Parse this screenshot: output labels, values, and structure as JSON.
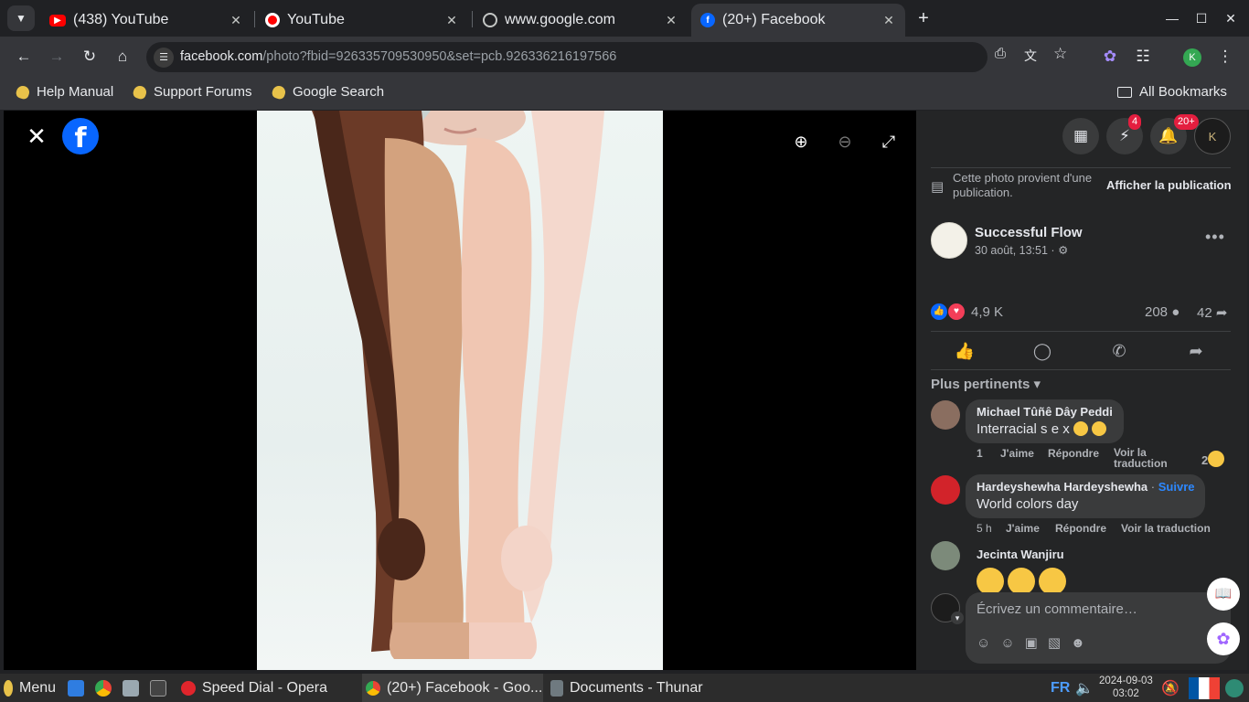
{
  "browser": {
    "tabs": [
      {
        "label": "(438) YouTube",
        "icon": "youtube-icon"
      },
      {
        "label": "YouTube",
        "icon": "youtube-music-icon"
      },
      {
        "label": "www.google.com",
        "icon": "globe-icon"
      },
      {
        "label": "(20+) Facebook",
        "icon": "facebook-icon",
        "active": true
      }
    ],
    "url_host": "facebook.com",
    "url_path": "/photo?fbid=926335709530950&set=pcb.926336216197566",
    "profile_initial": "K",
    "bookmarks": [
      "Help Manual",
      "Support Forums",
      "Google Search"
    ],
    "all_bookmarks": "All Bookmarks"
  },
  "panel": {
    "messenger_badge": "4",
    "notifications_badge": "20+",
    "notice": "Cette photo provient d'une publication.",
    "view_post": "Afficher la publication",
    "page_name": "Successful Flow",
    "post_date": "30 août, 13:51 ·",
    "reactions_count": "4,9 K",
    "comments_count": "208",
    "shares_count": "42",
    "sort_label": "Plus pertinents",
    "comments": [
      {
        "name": "Michael Tûñê Dây Peddi",
        "text": "Interracial s e x",
        "time": "1",
        "like": "J'aime",
        "reply": "Répondre",
        "translate": "Voir la traduction",
        "reactions": "2"
      },
      {
        "name": "Hardeyshewha Hardeyshewha",
        "follow": "Suivre",
        "text": "World colors day",
        "time": "5 h",
        "like": "J'aime",
        "reply": "Répondre",
        "translate": "Voir la traduction"
      },
      {
        "name": "Jecinta Wanjiru"
      }
    ],
    "comment_placeholder": "Écrivez un commentaire…"
  },
  "taskbar": {
    "menu": "Menu",
    "items": [
      "Speed Dial - Opera",
      "(20+) Facebook - Goo...",
      "Documents - Thunar"
    ],
    "lang": "FR",
    "date": "2024-09-03",
    "time": "03:02"
  },
  "colors": {
    "fb_blue": "#0866ff",
    "badge_red": "#e41e3f",
    "panel_bg": "#242526"
  }
}
